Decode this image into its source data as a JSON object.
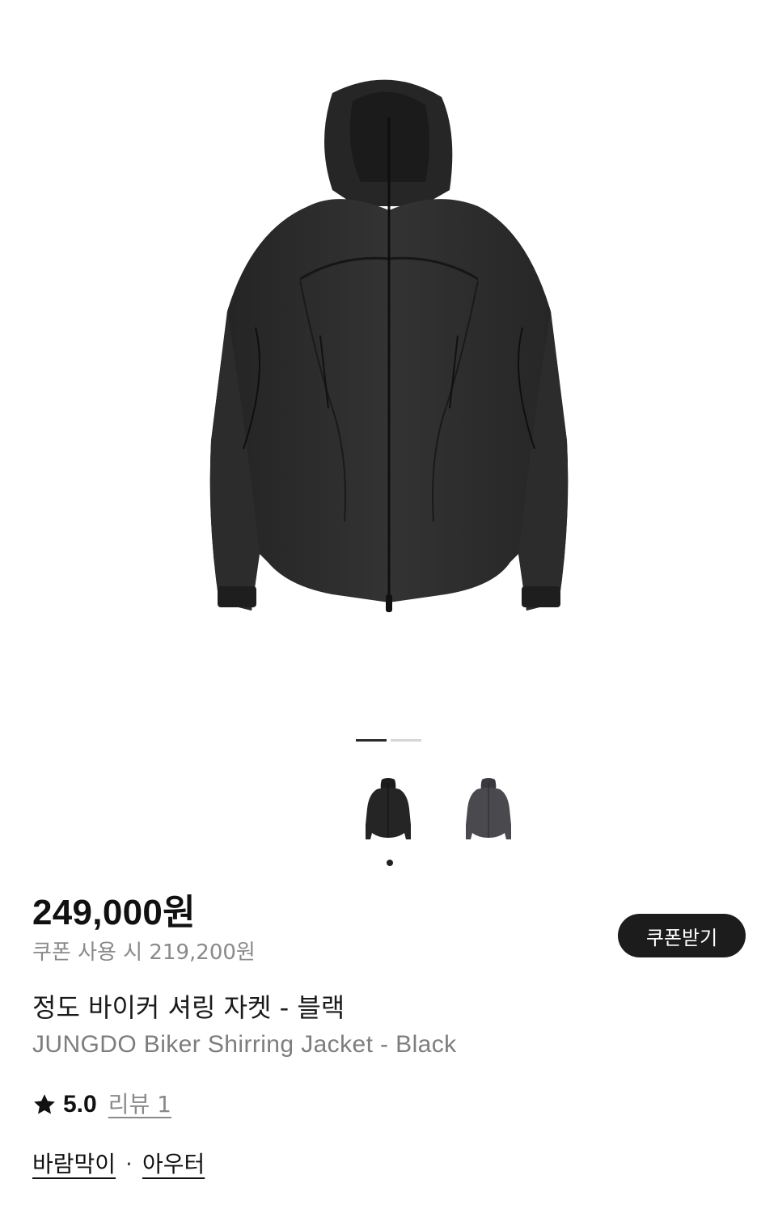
{
  "gallery": {
    "main_image": "black-hooded-shirring-jacket",
    "slides_total": 2,
    "active_slide": 1,
    "color_options": [
      {
        "name": "black-jacket-thumbnail",
        "color": "#222222",
        "selected": true
      },
      {
        "name": "charcoal-jacket-thumbnail",
        "color": "#4a4a4e",
        "selected": false
      }
    ]
  },
  "product": {
    "price": "249,000원",
    "coupon_price": "쿠폰 사용 시 219,200원",
    "coupon_button": "쿠폰받기",
    "name_ko": "정도 바이커 셔링 자켓 - 블랙",
    "name_en": "JUNGDO Biker Shirring Jacket - Black",
    "rating": "5.0",
    "reviews": "리뷰 1",
    "categories": [
      "바람막이",
      "아우터"
    ],
    "category_separator": "·"
  },
  "colors": {
    "button_bg": "#1c1c1c",
    "muted_text": "#8a8a8a",
    "jacket": "#2b2b2b"
  }
}
